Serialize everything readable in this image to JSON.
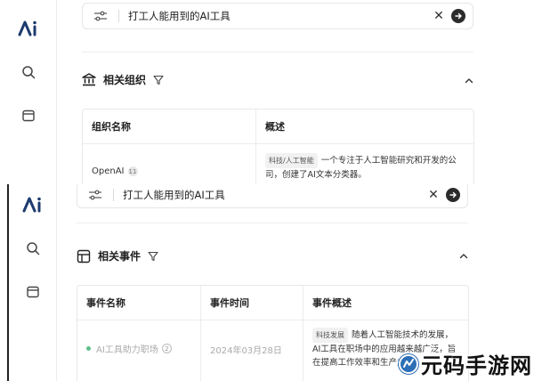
{
  "top": {
    "search": {
      "query": "打工人能用到的AI工具"
    },
    "section": {
      "title": "相关组织"
    },
    "table": {
      "headers": [
        "组织名称",
        "概述"
      ],
      "rows": [
        {
          "name": "OpenAI",
          "badge": "11",
          "tag": "科技/人工智能",
          "desc_line1": "一个专注于人工智能研究和开发的公",
          "desc_line2": "司，创建了AI文本分类器。"
        }
      ]
    }
  },
  "bottom": {
    "search": {
      "query": "打工人能用到的AI工具"
    },
    "section": {
      "title": "相关事件"
    },
    "table": {
      "headers": [
        "事件名称",
        "事件时间",
        "事件概述"
      ],
      "rows": [
        {
          "name": "AI工具助力职场",
          "badge": "2",
          "time": "2024年03月28日",
          "tag": "科技发展",
          "desc_line1": "随着人工智能技术的发展，",
          "desc_line2": "AI工具在职场中的应用越来越广泛，旨",
          "desc_line3": "在提高工作效率和生产力。"
        }
      ]
    }
  },
  "watermark": {
    "text": "元码手游网"
  },
  "colors": {
    "accent_green": "#5cc08a",
    "dark": "#2b2b2b",
    "watermark_blue": "#2d6fb7"
  }
}
